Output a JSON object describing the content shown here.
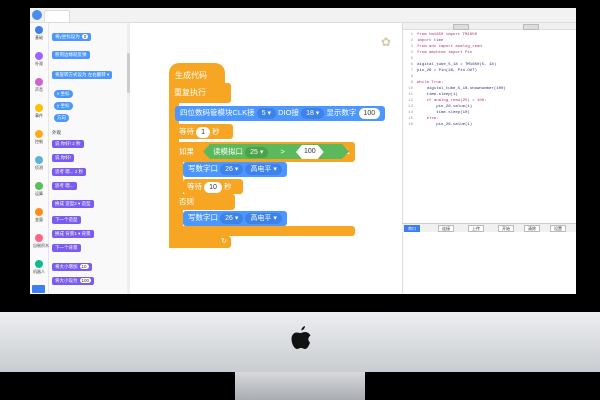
{
  "tabs": [
    "",
    "",
    ""
  ],
  "categories": [
    {
      "label": "基础",
      "color": "#3d7ff0"
    },
    {
      "label": "外观",
      "color": "#9966ff"
    },
    {
      "label": "声音",
      "color": "#cf63cf"
    },
    {
      "label": "事件",
      "color": "#ffbf00"
    },
    {
      "label": "控制",
      "color": "#ffab19"
    },
    {
      "label": "侦测",
      "color": "#5cb1d6"
    },
    {
      "label": "运算",
      "color": "#59c059"
    },
    {
      "label": "变量",
      "color": "#ff8c1a"
    },
    {
      "label": "自制积木",
      "color": "#ff6680"
    },
    {
      "label": "机器人",
      "color": "#0fbd8c"
    }
  ],
  "palette": {
    "blocks": [
      {
        "text": "将y坐标设为",
        "value": "0"
      },
      {
        "text": "移到边缘就反弹",
        "value": ""
      },
      {
        "text": "将旋转方式设为 左右翻转 ▾",
        "value": ""
      },
      {
        "text": "x 坐标",
        "value": ""
      },
      {
        "text": "y 坐标",
        "value": ""
      },
      {
        "text": "方向",
        "value": ""
      },
      {
        "text": "说 你好! 2 秒",
        "value": ""
      },
      {
        "text": "说 你好!",
        "value": ""
      },
      {
        "text": "思考 嗯... 2 秒",
        "value": ""
      },
      {
        "text": "思考 嗯...",
        "value": ""
      },
      {
        "text": "换成 造型2 ▾ 造型",
        "value": ""
      },
      {
        "text": "下一个造型",
        "value": ""
      },
      {
        "text": "换成 背景1 ▾ 背景",
        "value": ""
      },
      {
        "text": "下一个背景",
        "value": ""
      },
      {
        "text": "将大小增加",
        "value": "10"
      },
      {
        "text": "将大小设为",
        "value": "100"
      }
    ],
    "section_label": "外观"
  },
  "script": {
    "hat": "生成代码",
    "forever": "重复执行",
    "display": {
      "text": "四位数码管模块CLK接",
      "clk": "5 ▾",
      "dio_label": "DIO接",
      "dio": "18 ▾",
      "show_label": "显示数字",
      "number": "100"
    },
    "wait1": {
      "label": "等待",
      "value": "1",
      "unit": "秒"
    },
    "if_label": "如果",
    "if_then": "那么",
    "condition": {
      "sensor": "读模拟口",
      "pin": "25 ▾",
      "op": ">",
      "value": "100"
    },
    "write1": {
      "label": "写数字口",
      "pin": "26 ▾",
      "level": "高电平 ▾"
    },
    "wait2": {
      "label": "等待",
      "value": "10",
      "unit": "秒"
    },
    "else_label": "否则",
    "write2": {
      "label": "写数字口",
      "pin": "26 ▾",
      "level": "高电平 ▾"
    }
  },
  "zoom": {
    "in": "+",
    "out": "−",
    "reset": "="
  },
  "code_lines": [
    {
      "n": "1",
      "t": "from tm1650 import TM1650"
    },
    {
      "n": "2",
      "t": "import time"
    },
    {
      "n": "3",
      "t": "from adc import analog_read"
    },
    {
      "n": "4",
      "t": "from machine import Pin"
    },
    {
      "n": "5",
      "t": ""
    },
    {
      "n": "6",
      "t": "digital_tube_5_18 = TM1650(5, 18)"
    },
    {
      "n": "7",
      "t": "pin_26 = Pin(26, Pin.OUT)"
    },
    {
      "n": "8",
      "t": ""
    },
    {
      "n": "9",
      "t": "while True:"
    },
    {
      "n": "10",
      "t": "    digital_tube_5_18.shownumber(100)"
    },
    {
      "n": "11",
      "t": "    time.sleep(1)"
    },
    {
      "n": "12",
      "t": "    if analog_read(25) > 100:"
    },
    {
      "n": "13",
      "t": "        pin_26.value(1)"
    },
    {
      "n": "14",
      "t": "        time.sleep(10)"
    },
    {
      "n": "15",
      "t": "    else:"
    },
    {
      "n": "16",
      "t": "        pin_26.value(1)"
    }
  ],
  "serial_buttons": [
    "串口",
    "连接",
    "上传",
    "开始",
    "清除",
    "设置"
  ]
}
